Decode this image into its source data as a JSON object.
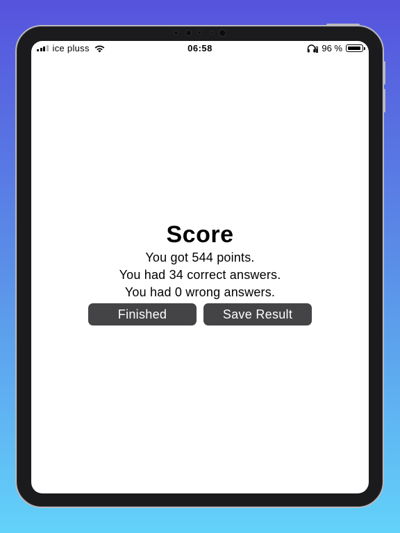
{
  "status_bar": {
    "carrier": "ice pluss",
    "time": "06:58",
    "battery_text": "96 %",
    "battery_level": 0.96,
    "icons": [
      "signal-icon",
      "wifi-icon",
      "headphones-icon",
      "battery-icon"
    ]
  },
  "score_screen": {
    "title": "Score",
    "points_line": "You got 544 points.",
    "correct_line": "You had 34 correct answers.",
    "wrong_line": "You had 0 wrong answers.",
    "finished_label": "Finished",
    "save_label": "Save Result"
  },
  "colors": {
    "background_top": "#5653DD",
    "background_bottom": "#63D2FA",
    "button_bg": "#444446",
    "button_text": "#FFFFFF",
    "screen_bg": "#FFFFFF"
  }
}
